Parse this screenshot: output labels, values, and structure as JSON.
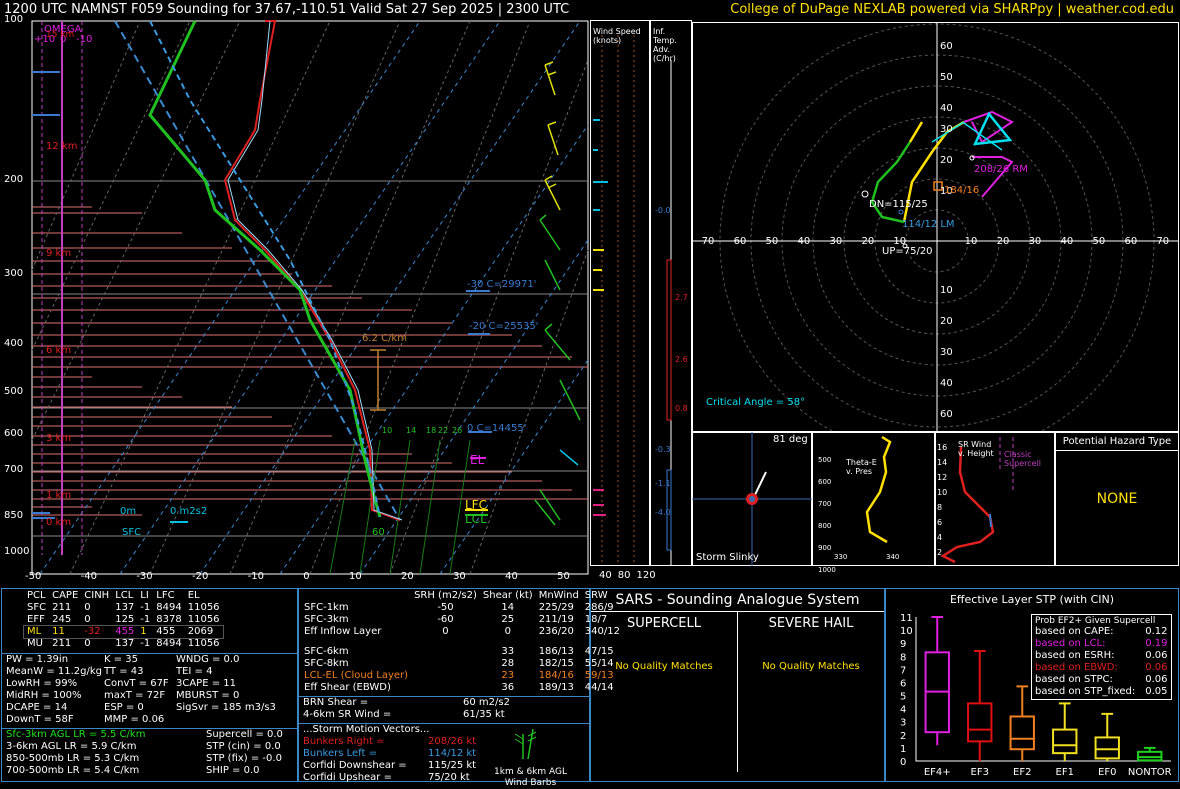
{
  "header": {
    "title": "1200 UTC NAMNST F059 Sounding for 37.67,-110.51 Valid  Sat 27 Sep 2025 | 2300 UTC",
    "credit": "College of DuPage NEXLAB powered via SHARPpy | weather.cod.edu"
  },
  "skewt": {
    "pressure_ticks": [
      "100",
      "200",
      "300",
      "400",
      "500",
      "600",
      "700",
      "850",
      "1000"
    ],
    "temp_ticks": [
      "-50",
      "-40",
      "-30",
      "-20",
      "-10",
      "0",
      "10",
      "20",
      "30",
      "40",
      "50"
    ],
    "height_labels": [
      "15 km",
      "12 km",
      "9 km",
      "6 km",
      "3 km",
      "1 km",
      "0 km"
    ],
    "omega_label": "OMEGA",
    "omega_scale": [
      "+10",
      "0",
      "-10"
    ],
    "annotations": {
      "lapse": "6.2 C/km",
      "minus30": "-30 C=29971'",
      "minus20": "-20 C=25535'",
      "zero": "0 C=14455'",
      "el": "EL",
      "lfc": "LFC",
      "lcl": "LCL",
      "sfc": "SFC",
      "zero_m": "0m",
      "srh": "0 m2s2",
      "sixty": "60"
    },
    "wetbulb_labels": [
      "10",
      "14",
      "18",
      "22",
      "26"
    ]
  },
  "side": {
    "wind_speed": "Wind Speed (knots)",
    "inf_temp": "Inf. Temp. Adv. (C/hr)",
    "speed_ticks": [
      "40",
      "80",
      "120"
    ],
    "adv_values": [
      "-0.0",
      "2.7",
      "2.6",
      "0.8",
      "-0.3",
      "-1.1",
      "-4.0"
    ]
  },
  "hodo": {
    "rings": [
      "10",
      "20",
      "30",
      "40",
      "50",
      "60"
    ],
    "x_ticks": [
      "70",
      "60",
      "50",
      "40",
      "30",
      "20",
      "10",
      "10",
      "20",
      "30",
      "40",
      "50",
      "60",
      "70"
    ],
    "rm": "208/26 RM",
    "lm": "114/12 LM",
    "mean": "184/16",
    "dn": "DN=115/25",
    "up": "UP=75/20",
    "critical": "Critical Angle = 58°"
  },
  "slinky": {
    "deg": "81 deg",
    "label": "Storm Slinky"
  },
  "thetae": {
    "label": "Theta-E v. Pres",
    "p_ticks": [
      "500",
      "600",
      "700",
      "800",
      "900",
      "1000"
    ],
    "x_ticks": [
      "330",
      "340"
    ]
  },
  "srwind": {
    "label": "SR Wind v. Height",
    "classic": "Classic Supercell",
    "h_ticks": [
      "16",
      "14",
      "12",
      "10",
      "8",
      "6",
      "4",
      "2"
    ]
  },
  "hazard": {
    "title": "Potential Hazard Type",
    "value": "NONE"
  },
  "parcels": {
    "headers": [
      "PCL",
      "CAPE",
      "CINH",
      "LCL",
      "LI",
      "LFC",
      "EL"
    ],
    "rows": [
      [
        "SFC",
        "211",
        "0",
        "137",
        "-1",
        "8494",
        "11056"
      ],
      [
        "EFF",
        "245",
        "0",
        "125",
        "-1",
        "8378",
        "11056"
      ],
      [
        "ML",
        "11",
        "-32",
        "455",
        "1",
        "455",
        "2069"
      ],
      [
        "MU",
        "211",
        "0",
        "137",
        "-1",
        "8494",
        "11056"
      ]
    ]
  },
  "indices": {
    "col1": [
      "PW = 1.39in",
      "MeanW = 11.2g/kg",
      "LowRH = 99%",
      "MidRH = 100%",
      "DCAPE = 14",
      "DownT = 58F"
    ],
    "col2": [
      "K = 35",
      "TT = 43",
      "ConvT = 67F",
      "maxT = 72F",
      "ESP = 0",
      "MMP = 0.06"
    ],
    "col3": [
      "WNDG = 0.0",
      "TEI = 4",
      "3CAPE = 11",
      "MBURST = 0",
      "",
      "SigSvr = 185 m3/s3"
    ]
  },
  "lapse": [
    "Sfc-3km AGL LR = 5.5 C/km",
    "3-6km AGL LR = 5.9 C/km",
    "850-500mb LR = 5.3 C/km",
    "700-500mb LR = 5.4 C/km"
  ],
  "composite": [
    "Supercell = 0.0",
    "STP (cin) = 0.0",
    "STP (fix) = -0.0",
    "SHIP = 0.0"
  ],
  "kinematics": {
    "headers": [
      "",
      "SRH (m2/s2)",
      "Shear (kt)",
      "MnWind",
      "SRW"
    ],
    "rows": [
      [
        "SFC-1km",
        "-50",
        "14",
        "225/29",
        "286/9"
      ],
      [
        "SFC-3km",
        "-60",
        "25",
        "211/19",
        "18/7"
      ],
      [
        "Eff Inflow Layer",
        "0",
        "0",
        "236/20",
        "340/12"
      ],
      [
        "",
        "",
        "",
        "",
        ""
      ],
      [
        "SFC-6km",
        "",
        "33",
        "186/13",
        "47/15"
      ],
      [
        "SFC-8km",
        "",
        "28",
        "182/15",
        "55/14"
      ],
      [
        "LCL-EL (Cloud Layer)",
        "",
        "23",
        "184/16",
        "59/13"
      ],
      [
        "Eff Shear (EBWD)",
        "",
        "36",
        "189/13",
        "44/14"
      ]
    ],
    "brn_shear": "BRN Shear =",
    "brn_shear_v": "60 m2/s2",
    "sr_wind": "4-6km SR Wind =",
    "sr_wind_v": "61/35 kt",
    "storm_title": "...Storm Motion Vectors...",
    "br": "Bunkers Right =",
    "br_v": "208/26 kt",
    "bl": "Bunkers Left =",
    "bl_v": "114/12 kt",
    "cd": "Corfidi Downshear =",
    "cd_v": "115/25 kt",
    "cu": "Corfidi Upshear =",
    "cu_v": "75/20 kt",
    "barbs": "1km & 6km AGL Wind Barbs"
  },
  "sars": {
    "title": "SARS - Sounding Analogue System",
    "supercell": "SUPERCELL",
    "hail": "SEVERE HAIL",
    "sup_match": "No Quality Matches",
    "hail_match": "No Quality Matches"
  },
  "stp": {
    "title": "Effective Layer STP (with CIN)",
    "y_ticks": [
      "0",
      "1",
      "2",
      "3",
      "4",
      "5",
      "6",
      "7",
      "8",
      "9",
      "10",
      "11"
    ],
    "categories": [
      "EF4+",
      "EF3",
      "EF2",
      "EF1",
      "EF0",
      "NONTOR"
    ],
    "legend_title": "Prob EF2+ Given Supercell",
    "legend": [
      [
        "based on CAPE:",
        "0.12"
      ],
      [
        "based on LCL:",
        "0.19"
      ],
      [
        "based on ESRH:",
        "0.06"
      ],
      [
        "based on EBWD:",
        "0.06"
      ],
      [
        "based on STPC:",
        "0.06"
      ],
      [
        "based on STP_fixed:",
        "0.05"
      ]
    ]
  },
  "chart_data": {
    "type": "box",
    "title": "Effective Layer STP (with CIN)",
    "categories": [
      "EF4+",
      "EF3",
      "EF2",
      "EF1",
      "EF0",
      "NONTOR"
    ],
    "boxes": [
      {
        "whisker_low": 1.2,
        "q1": 2.2,
        "median": 5.3,
        "q3": 8.3,
        "whisker_high": 11.0
      },
      {
        "whisker_low": 0.0,
        "q1": 1.5,
        "median": 2.4,
        "q3": 4.4,
        "whisker_high": 8.4
      },
      {
        "whisker_low": 0.0,
        "q1": 0.9,
        "median": 1.7,
        "q3": 3.4,
        "whisker_high": 5.7
      },
      {
        "whisker_low": 0.0,
        "q1": 0.6,
        "median": 1.2,
        "q3": 2.4,
        "whisker_high": 4.4
      },
      {
        "whisker_low": 0.0,
        "q1": 0.2,
        "median": 0.9,
        "q3": 1.8,
        "whisker_high": 3.6
      },
      {
        "whisker_low": 0.0,
        "q1": 0.05,
        "median": 0.3,
        "q3": 0.7,
        "whisker_high": 1.0
      }
    ],
    "colors": [
      "#e020e0",
      "#e01010",
      "#f08020",
      "#f0e020",
      "#f0e020",
      "#20d020"
    ],
    "ylim": [
      0,
      11
    ]
  }
}
